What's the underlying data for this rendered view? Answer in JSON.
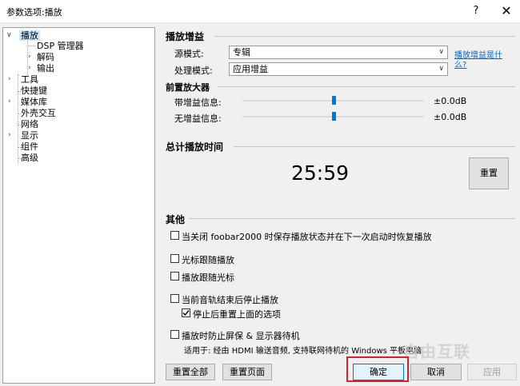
{
  "window": {
    "title": "参数选项:播放",
    "help": "?",
    "close": "✕"
  },
  "tree": {
    "items": [
      {
        "label": "播放"
      },
      {
        "label": "DSP 管理器"
      },
      {
        "label": "解码"
      },
      {
        "label": "输出"
      },
      {
        "label": "工具"
      },
      {
        "label": "快捷键"
      },
      {
        "label": "媒体库"
      },
      {
        "label": "外壳交互"
      },
      {
        "label": "网络"
      },
      {
        "label": "显示"
      },
      {
        "label": "组件"
      },
      {
        "label": "高级"
      }
    ]
  },
  "playback_gain": {
    "title": "播放增益",
    "source_mode_label": "源模式:",
    "source_mode_value": "专辑",
    "processing_mode_label": "处理模式:",
    "processing_mode_value": "应用增益",
    "help_link": "播放增益是什么?"
  },
  "preamp": {
    "title": "前置放大器",
    "with_info_label": "带增益信息:",
    "with_info_value": "±0.0dB",
    "with_info_level": 0.5,
    "without_info_label": "无增益信息:",
    "without_info_value": "±0.0dB",
    "without_info_level": 0.5
  },
  "total_time": {
    "title": "总计播放时间",
    "value": "25:59",
    "reset_label": "重置"
  },
  "other": {
    "title": "其他",
    "options": [
      {
        "label": "当关闭 foobar2000 时保存播放状态并在下一次启动时恢复播放",
        "checked": false
      },
      {
        "label": "光标跟随播放",
        "checked": false
      },
      {
        "label": "播放跟随光标",
        "checked": false
      },
      {
        "label": "当前音轨结束后停止播放",
        "checked": false
      },
      {
        "label": "停止后重置上面的选项",
        "checked": true
      },
      {
        "label": "播放时防止屏保 & 显示器待机",
        "checked": false
      }
    ],
    "note": "适用于: 经由 HDMI 输送音频, 支持联网待机的 Windows 平板电脑"
  },
  "footer": {
    "reset_all": "重置全部",
    "reset_page": "重置页面",
    "ok": "确定",
    "cancel": "取消",
    "apply": "应用"
  },
  "watermark": "自由互联",
  "colors": {
    "accent": "#0078d7",
    "highlight_box": "#d9202a",
    "link": "#0066cc"
  }
}
